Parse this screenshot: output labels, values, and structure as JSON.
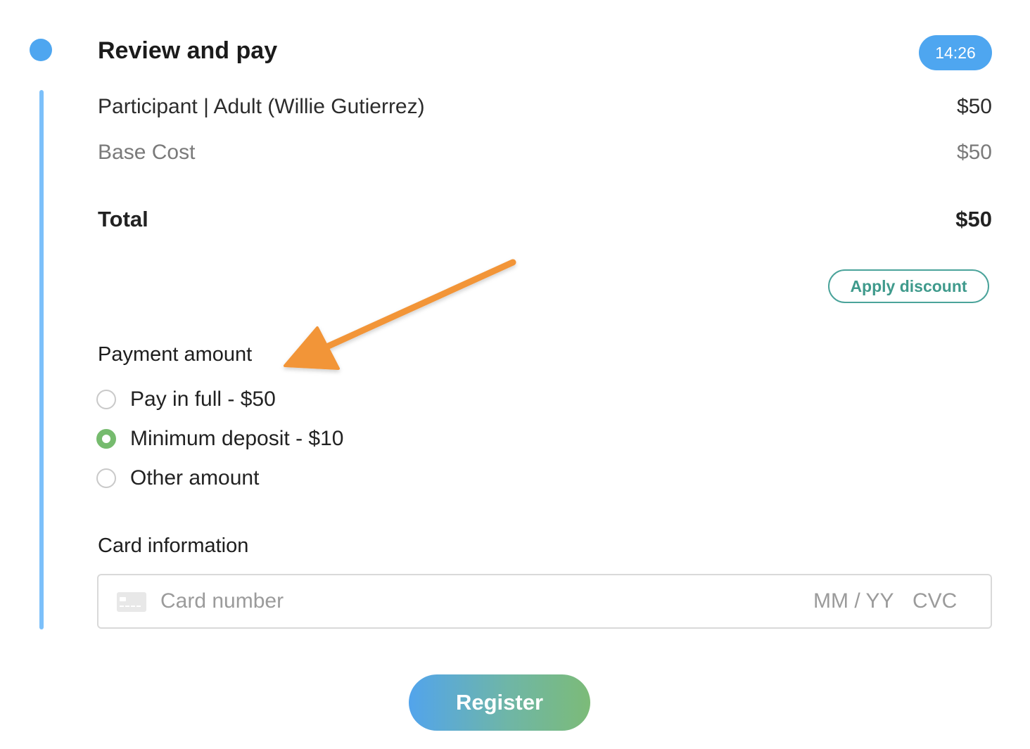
{
  "step": {
    "title": "Review and pay",
    "timer": "14:26"
  },
  "summary": {
    "participant_label": "Participant | Adult (Willie Gutierrez)",
    "participant_price": "$50",
    "base_cost_label": "Base Cost",
    "base_cost_price": "$50",
    "total_label": "Total",
    "total_price": "$50"
  },
  "discount": {
    "button_label": "Apply discount"
  },
  "payment": {
    "heading": "Payment amount",
    "options": [
      {
        "label": "Pay in full - $50",
        "selected": false
      },
      {
        "label": "Minimum deposit - $10",
        "selected": true
      },
      {
        "label": "Other amount",
        "selected": false
      }
    ]
  },
  "card": {
    "heading": "Card information",
    "number_placeholder": "Card number",
    "expiry_placeholder": "MM / YY",
    "cvc_placeholder": "CVC"
  },
  "register": {
    "button_label": "Register"
  },
  "colors": {
    "accent_blue": "#4ea6f0",
    "timeline": "#7cc0fa",
    "selected_green": "#76bb6e",
    "discount_teal": "#3f9a8c",
    "annotation_orange": "#f29539"
  },
  "icons": {
    "card": "credit-card-icon",
    "annotation": "orange-arrow-annotation"
  }
}
